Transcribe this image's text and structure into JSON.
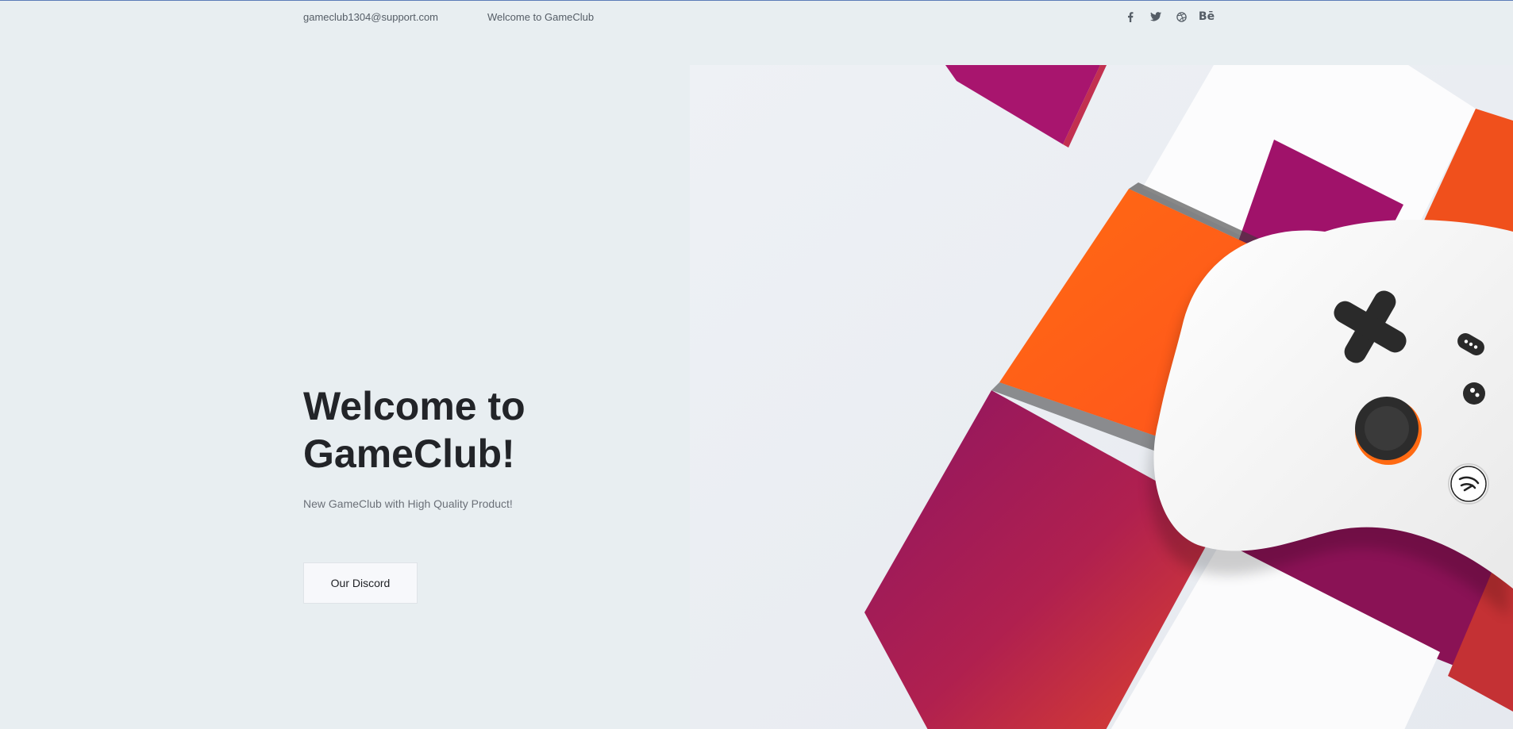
{
  "topbar": {
    "email": "gameclub1304@support.com",
    "welcome": "Welcome to GameClub",
    "social": [
      {
        "icon": "facebook-icon",
        "label": "f"
      },
      {
        "icon": "twitter-icon",
        "label": ""
      },
      {
        "icon": "dribbble-icon",
        "label": ""
      },
      {
        "icon": "behance-icon",
        "label": "Bē"
      }
    ]
  },
  "hero": {
    "title": "Welcome to GameClub!",
    "subtitle": "New GameClub with High Quality Product!",
    "button_label": "Our Discord",
    "image_description_colors": {
      "magenta": "#a3195b",
      "orange": "#ff5a1c",
      "controller": "#f4f4f4"
    }
  }
}
